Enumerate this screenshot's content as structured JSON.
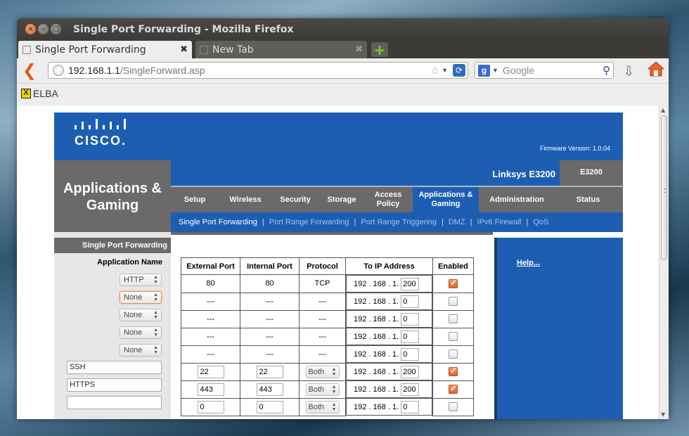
{
  "window": {
    "title": "Single Port Forwarding - Mozilla Firefox"
  },
  "tabs": [
    {
      "label": "Single Port Forwarding",
      "close": "✖"
    },
    {
      "label": "New Tab",
      "close": "✖"
    }
  ],
  "nav": {
    "url_host": "192.168.1.1",
    "url_path": "/SingleForward.asp",
    "search_placeholder": "Google"
  },
  "bookmarks": [
    {
      "label": "ELBA"
    }
  ],
  "router": {
    "brand": "CISCO.",
    "firmware": "Firmware Version: 1.0.04",
    "section": "Applications & Gaming",
    "product": "Linksys E3200",
    "model": "E3200",
    "tabs": [
      "Setup",
      "Wireless",
      "Security",
      "Storage",
      "Access Policy",
      "Applications & Gaming",
      "Administration",
      "Status"
    ],
    "subtabs": [
      "Single Port Forwarding",
      "Port Range Forwarding",
      "Port Range Triggering",
      "DMZ",
      "IPv6 Firewall",
      "QoS"
    ],
    "subtab_sep": "|",
    "sidebar_title": "Single Port Forwarding",
    "sidebar_sub": "Application Name",
    "app_selects": [
      "HTTP",
      "None",
      "None",
      "None",
      "None"
    ],
    "app_texts": [
      "SSH",
      "HTTPS",
      ""
    ],
    "help": "Help...",
    "table_headers": [
      "External Port",
      "Internal Port",
      "Protocol",
      "To IP Address",
      "Enabled"
    ],
    "ip_prefix": "192 . 168 . 1.",
    "rows": [
      {
        "ext": "80",
        "int": "80",
        "proto": "TCP",
        "ip": "200",
        "enabled": true
      },
      {
        "ext": "---",
        "int": "---",
        "proto": "---",
        "ip": "0",
        "enabled": false
      },
      {
        "ext": "---",
        "int": "---",
        "proto": "---",
        "ip": "0",
        "enabled": false
      },
      {
        "ext": "---",
        "int": "---",
        "proto": "---",
        "ip": "0",
        "enabled": false
      },
      {
        "ext": "---",
        "int": "---",
        "proto": "---",
        "ip": "0",
        "enabled": false
      },
      {
        "ext": "22",
        "int": "22",
        "proto": "Both",
        "ip": "200",
        "enabled": true
      },
      {
        "ext": "443",
        "int": "443",
        "proto": "Both",
        "ip": "200",
        "enabled": true
      },
      {
        "ext": "0",
        "int": "0",
        "proto": "Both",
        "ip": "0",
        "enabled": false
      }
    ]
  },
  "colors": {
    "cisco_blue": "#1d5eb3",
    "grey": "#6a6a6a",
    "check_orange": "#e3632c"
  }
}
